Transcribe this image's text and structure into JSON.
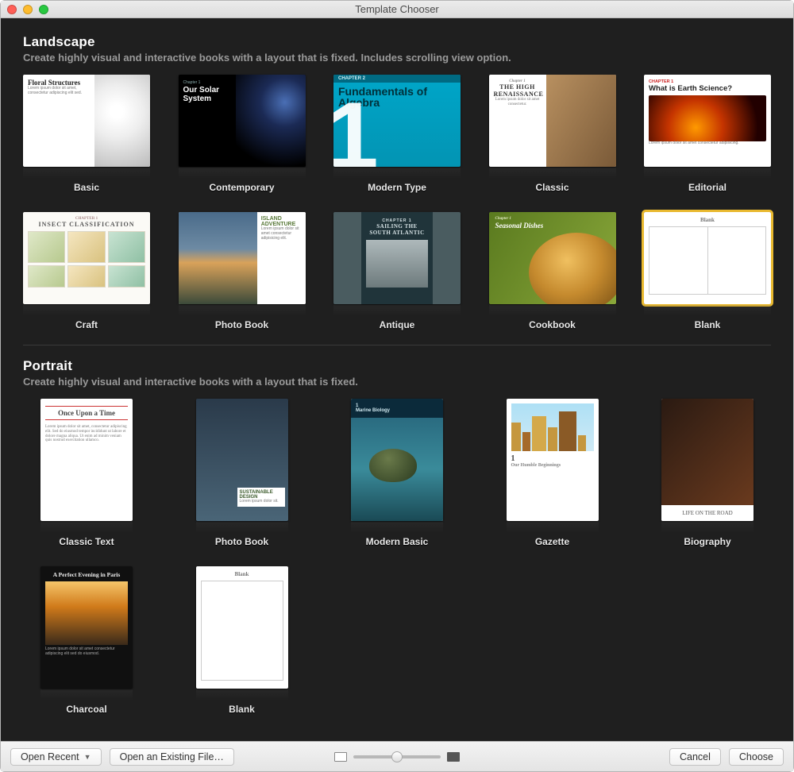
{
  "window": {
    "title": "Template Chooser"
  },
  "sections": {
    "landscape": {
      "title": "Landscape",
      "subtitle": "Create highly visual and interactive books with a layout that is fixed. Includes scrolling view option.",
      "templates": [
        {
          "label": "Basic",
          "preview": {
            "title": "Floral Structures"
          }
        },
        {
          "label": "Contemporary",
          "preview": {
            "title": "Our Solar System"
          }
        },
        {
          "label": "Modern Type",
          "preview": {
            "title": "Fundamentals of Algebra",
            "chapter": "CHAPTER 2"
          }
        },
        {
          "label": "Classic",
          "preview": {
            "chapter": "Chapter 1",
            "title": "THE HIGH RENAISSANCE"
          }
        },
        {
          "label": "Editorial",
          "preview": {
            "chapter": "CHAPTER 1",
            "title": "What is Earth Science?"
          }
        },
        {
          "label": "Craft",
          "preview": {
            "chapter": "CHAPTER 1",
            "title": "INSECT CLASSIFICATION"
          }
        },
        {
          "label": "Photo Book",
          "preview": {
            "title": "ISLAND ADVENTURE"
          }
        },
        {
          "label": "Antique",
          "preview": {
            "chapter": "CHAPTER 1",
            "title": "SAILING THE SOUTH ATLANTIC"
          }
        },
        {
          "label": "Cookbook",
          "preview": {
            "chapter": "Chapter 1",
            "title": "Seasonal Dishes"
          }
        },
        {
          "label": "Blank",
          "preview": {
            "title": "Blank"
          },
          "selected": true
        }
      ]
    },
    "portrait": {
      "title": "Portrait",
      "subtitle": "Create highly visual and interactive books with a layout that is fixed.",
      "templates": [
        {
          "label": "Classic Text",
          "preview": {
            "title": "Once Upon a Time"
          }
        },
        {
          "label": "Photo Book",
          "preview": {
            "title": "SUSTAINABLE DESIGN"
          }
        },
        {
          "label": "Modern Basic",
          "preview": {
            "chapter": "1",
            "title": "Marine Biology"
          }
        },
        {
          "label": "Gazette",
          "preview": {
            "chapter": "1",
            "title": "Our Humble Beginnings"
          }
        },
        {
          "label": "Biography",
          "preview": {
            "title": "LIFE ON THE ROAD"
          }
        },
        {
          "label": "Charcoal",
          "preview": {
            "title": "A Perfect Evening in Paris"
          }
        },
        {
          "label": "Blank",
          "preview": {
            "title": "Blank"
          }
        }
      ]
    }
  },
  "footer": {
    "open_recent": "Open Recent",
    "open_existing": "Open an Existing File…",
    "cancel": "Cancel",
    "choose": "Choose"
  }
}
